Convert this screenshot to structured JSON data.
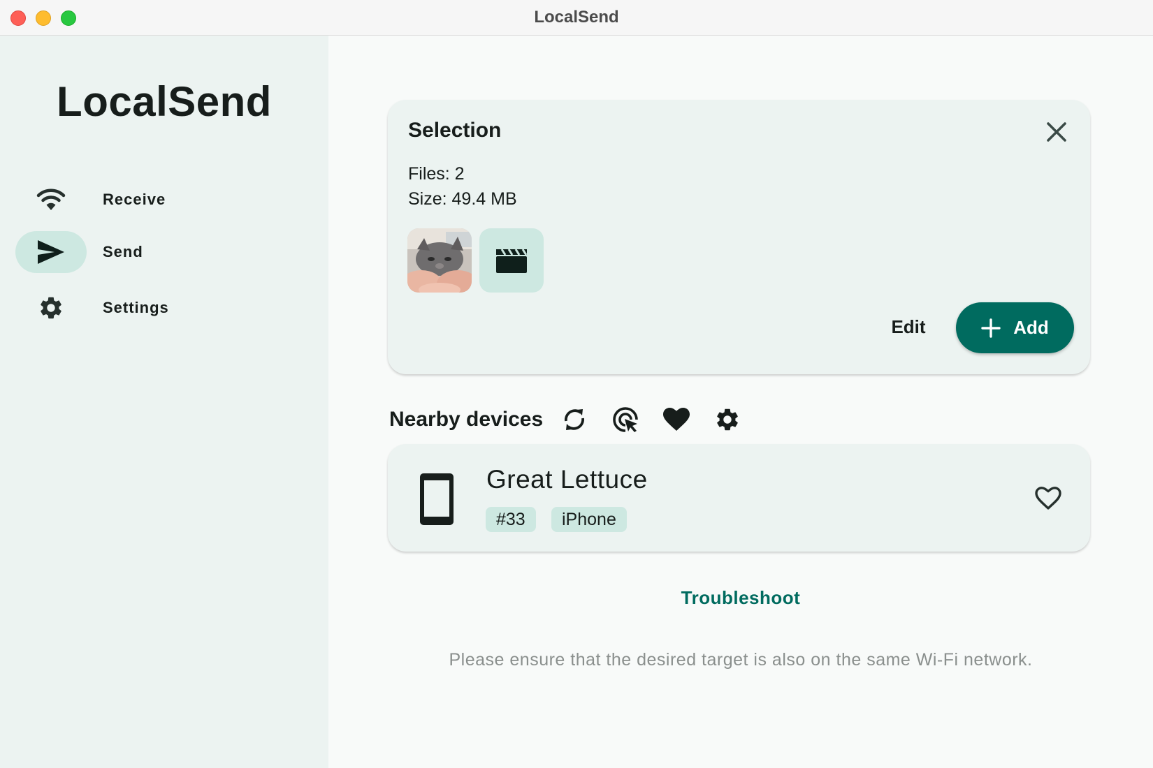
{
  "window": {
    "title": "LocalSend"
  },
  "sidebar": {
    "app_title": "LocalSend",
    "items": [
      {
        "label": "Receive",
        "icon": "wifi-icon",
        "active": false
      },
      {
        "label": "Send",
        "icon": "send-icon",
        "active": true
      },
      {
        "label": "Settings",
        "icon": "gear-icon",
        "active": false
      }
    ]
  },
  "selection": {
    "title": "Selection",
    "files_text": "Files: 2",
    "size_text": "Size: 49.4 MB",
    "thumbnails": [
      {
        "kind": "image",
        "icon": "cat-photo-thumbnail"
      },
      {
        "kind": "video",
        "icon": "clapperboard-icon"
      }
    ],
    "edit_label": "Edit",
    "add_label": "Add"
  },
  "nearby": {
    "label": "Nearby devices",
    "tools": [
      "refresh-icon",
      "scan-target-icon",
      "favorites-icon",
      "gear-icon"
    ]
  },
  "device": {
    "name": "Great Lettuce",
    "tags": [
      "#33",
      "iPhone"
    ],
    "icon": "phone-icon"
  },
  "troubleshoot_label": "Troubleshoot",
  "hint_text": "Please ensure that the desired target is also on the same Wi-Fi network.",
  "colors": {
    "accent": "#006b5f",
    "sidebar_bg": "#ecf3f1",
    "card_bg": "#ecf3f1",
    "chip_bg": "#cde8e1",
    "page_bg": "#f8faf9"
  }
}
